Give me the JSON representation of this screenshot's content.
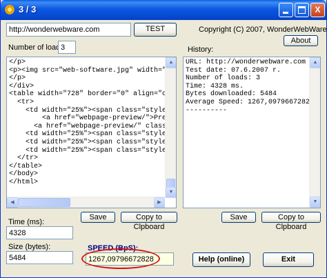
{
  "window": {
    "title": "3 / 3"
  },
  "titlebar_buttons": {
    "minimize": "minimize",
    "maximize": "maximize",
    "close": "X"
  },
  "url_input": {
    "value": "http://wonderwebware.com"
  },
  "test_button": {
    "label": "TEST"
  },
  "copyright": "Copyright (C) 2007, WonderWebWare.com",
  "about_button": {
    "label": "About"
  },
  "loads": {
    "label": "Number of loads:",
    "value": "3"
  },
  "history": {
    "label": "History:"
  },
  "source_lines": [
    "</p>",
    "<p><img src=\"web-software.jpg\" width=\"",
    "</p>",
    "</div>",
    "<table width=\"728\" border=\"0\" align=\"c",
    "  <tr>",
    "    <td width=\"25%\"><span class=\"style",
    "        <a href=\"webpage-preview/\">Pre",
    "      <a href=\"webpage-preview/\" class",
    "    <td width=\"25%\"><span class=\"style",
    "    <td width=\"25%\"><span class=\"style",
    "    <td width=\"25%\"><span class=\"style",
    "  </tr>",
    "</table>",
    "</body>",
    "</html>"
  ],
  "history_lines": [
    "URL: http://wonderwebware.com",
    "Test date: 07.6.2007 r.",
    "Number of loads: 3",
    "Time: 4328 ms.",
    "Bytes downloaded: 5484",
    "Average Speed: 1267,0979667282",
    "----------"
  ],
  "left_save": {
    "label": "Save"
  },
  "left_copy": {
    "label": "Copy to Clpboard"
  },
  "right_save": {
    "label": "Save"
  },
  "right_copy": {
    "label": "Copy to Clpboard"
  },
  "time": {
    "label": "Time (ms):",
    "value": "4328"
  },
  "size": {
    "label": "Size (bytes):",
    "value": "5484"
  },
  "speed": {
    "label": "SPEED (BpS):",
    "value": "1267,09796672828"
  },
  "help_button": {
    "label": "Help (online)"
  },
  "exit_button": {
    "label": "Exit"
  },
  "colors": {
    "title_bar": "#0a5fe3",
    "window_bg": "#ece9d8",
    "annotation": "#d11818"
  }
}
